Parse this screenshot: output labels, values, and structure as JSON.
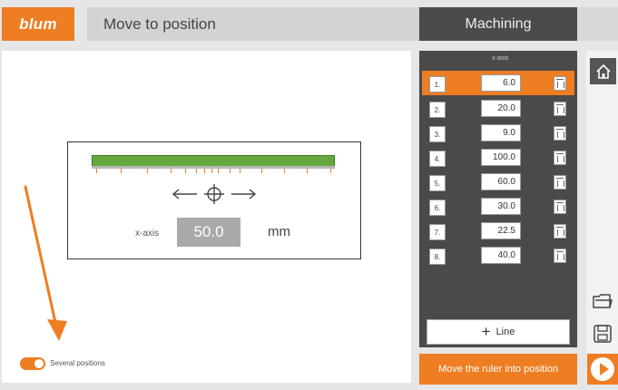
{
  "header": {
    "logo": "blum",
    "title": "Move to position",
    "mode": "Machining"
  },
  "main": {
    "axis_label": "x-axis",
    "value": "50.0",
    "unit": "mm",
    "toggle_label": "Several positions",
    "toggle_on": true
  },
  "list": {
    "column_header": "x-axis",
    "rows": [
      {
        "num": "1.",
        "value": "6.0",
        "selected": true
      },
      {
        "num": "2.",
        "value": "20.0",
        "selected": false
      },
      {
        "num": "3.",
        "value": "9.0",
        "selected": false
      },
      {
        "num": "4.",
        "value": "100.0",
        "selected": false
      },
      {
        "num": "5.",
        "value": "60.0",
        "selected": false
      },
      {
        "num": "6.",
        "value": "30.0",
        "selected": false
      },
      {
        "num": "7.",
        "value": "22.5",
        "selected": false
      },
      {
        "num": "8.",
        "value": "40.0",
        "selected": false
      }
    ],
    "add_line_label": "Line"
  },
  "action_label": "Move the ruler into position",
  "icons": {
    "home": "home-icon",
    "folder": "folder-icon",
    "save": "save-icon",
    "play": "play-icon",
    "trash": "trash-icon",
    "crosshair": "crosshair-icon"
  },
  "colors": {
    "accent": "#ef7d22",
    "dark_panel": "#4a4a4a",
    "ruler_green": "#65a840"
  }
}
